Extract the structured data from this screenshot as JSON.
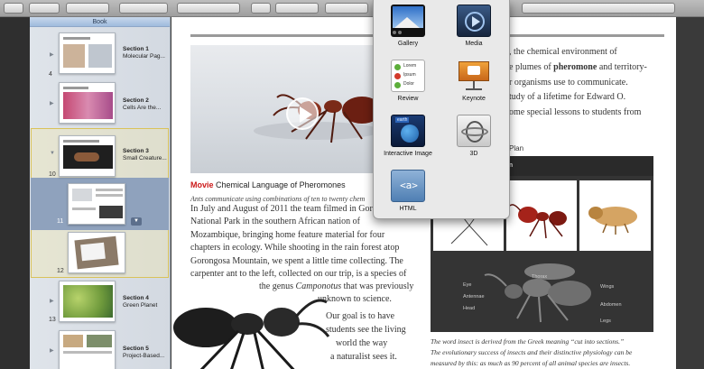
{
  "sidebar": {
    "header": "Book",
    "sections": [
      {
        "number": "4",
        "title": "Section 1",
        "subtitle": "Molecular Pag..."
      },
      {
        "number": "",
        "title": "Section 2",
        "subtitle": "Cells Are the..."
      },
      {
        "number": "10",
        "title": "Section 3",
        "subtitle": "Small Creature..."
      },
      {
        "number": "11",
        "title": "",
        "subtitle": ""
      },
      {
        "number": "12",
        "title": "",
        "subtitle": ""
      },
      {
        "number": "13",
        "title": "Section 4",
        "subtitle": "Green Planet"
      },
      {
        "number": "",
        "title": "Section 5",
        "subtitle": "Project-Based..."
      }
    ]
  },
  "popover": {
    "widgets": [
      {
        "label": "Gallery",
        "icon": "gallery-icon"
      },
      {
        "label": "Media",
        "icon": "media-icon"
      },
      {
        "label": "Review",
        "icon": "review-icon",
        "lines": [
          "Lorem",
          "Ipsum",
          "Dolor"
        ]
      },
      {
        "label": "Keynote",
        "icon": "keynote-icon"
      },
      {
        "label": "Interactive Image",
        "icon": "interactive-image-icon",
        "badge": "earth"
      },
      {
        "label": "3D",
        "icon": "3d-icon"
      },
      {
        "label": "HTML",
        "icon": "html-icon",
        "glyph": "<a>"
      }
    ]
  },
  "page": {
    "caption_tag": "Movie",
    "caption_text": "Chemical Language of Pheromones",
    "subcaption": "Ants communicate using combinations of ten to twenty chem",
    "body_lines": [
      "In July and August of 2011 the team filmed in Gor",
      "National Park in the southern African nation of",
      "Mozambique, bringing home feature material for four",
      "chapters in ecology. While shooting in the rain forest atop",
      "Gorongosa Mountain, we spent a little time collecting. The",
      "carpenter ant to the left, collected on our trip, is a species of"
    ],
    "genus_prefix": "the genus ",
    "genus_name": "Camponotus",
    "genus_suffix": " that was previously",
    "unknown_line": "unknown to science.",
    "goal_lines": [
      "Our goal is to have",
      "students see the living",
      "world the way",
      "a naturalist sees it."
    ],
    "right_lines": {
      "line1": ", the chemical environment of",
      "line2_pre": "e plumes of ",
      "line2_bold": "pheromone",
      "line2_post": " and territory-",
      "line3": "r organisms use to communicate.",
      "line4": "tudy of a lifetime for Edward O.",
      "line5": "ome special lessons to students from"
    },
    "plan_label": "Plan",
    "plan_header": "an",
    "diagram_labels": [
      "Eye",
      "Antennae",
      "Head",
      "Thorax",
      "Wings",
      "Abdomen",
      "Legs"
    ],
    "plan_caption_lines": [
      "The word insect is derived from the Greek meaning “cut into sections.”",
      "The evolutionary success of insects and their distinctive physiology can be",
      "measured by this: as much as 90 percent of all animal species are insects."
    ]
  },
  "colors": {
    "accent_red": "#cc1a1a",
    "sidebar_selection": "#8fa2bd",
    "panel_dark": "#343434"
  }
}
